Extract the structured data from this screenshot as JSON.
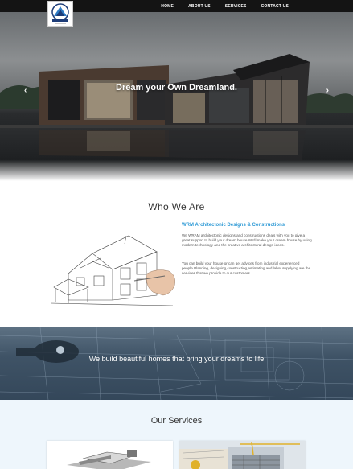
{
  "nav": {
    "links": [
      "HOME",
      "ABOUT US",
      "SERVICES",
      "CONTACT US"
    ]
  },
  "hero": {
    "title": "Dream your Own Dreamland.",
    "prev_arrow": "‹",
    "next_arrow": "›"
  },
  "about": {
    "title": "Who We Are",
    "subtitle": "WRM Architectonic Designs & Constructions",
    "paragraph1": "We WRAM architectonic designs and constructions deals with you to give a great support to build your dream house.We'll make your dream house by using modern technology and the creative architectural design ideas.",
    "paragraph2": "You can build your house or can get advices from industrial experienced people.Planning, designing,constructing,estimating and labor supplying are the services that we provide to our customers."
  },
  "banner": {
    "text": "We build beautiful homes that bring your dreams to life"
  },
  "services": {
    "title": "Our Services"
  },
  "colors": {
    "nav_bg": "#141414",
    "accent": "#2e9ad6",
    "services_bg": "#eef6fc"
  }
}
